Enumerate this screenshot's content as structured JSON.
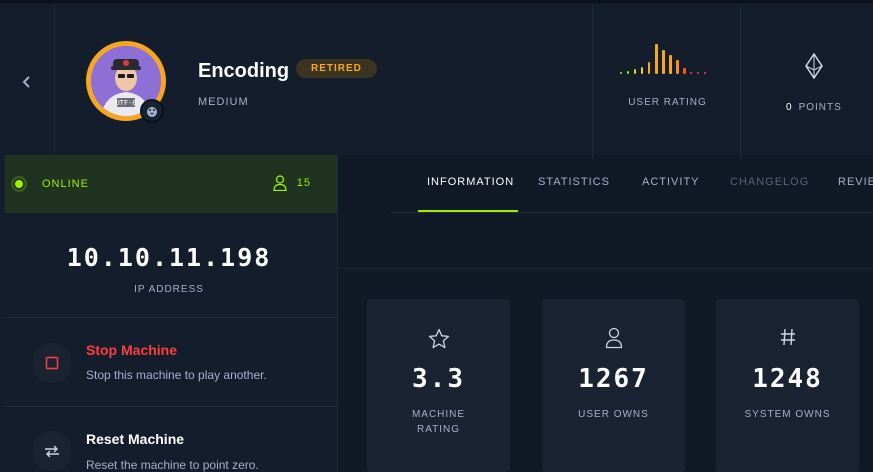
{
  "header": {
    "machine_name": "Encoding",
    "status_badge": "RETIRED",
    "difficulty": "MEDIUM",
    "user_rating_label": "USER RATING",
    "points_value": "0",
    "points_label": "POINTS"
  },
  "avatar": {
    "shirt_text": "UTF-8"
  },
  "left_panel": {
    "status": "ONLINE",
    "user_count": "15",
    "ip": "10.10.11.198",
    "ip_label": "IP ADDRESS",
    "actions": [
      {
        "title": "Stop Machine",
        "description": "Stop this machine to play another."
      },
      {
        "title": "Reset Machine",
        "description": "Reset the machine to point zero."
      }
    ]
  },
  "tabs": [
    "INFORMATION",
    "STATISTICS",
    "ACTIVITY",
    "CHANGELOG",
    "REVIE"
  ],
  "cards": [
    {
      "value": "3.3",
      "label": "MACHINE RATING",
      "icon": "star-icon"
    },
    {
      "value": "1267",
      "label": "USER OWNS",
      "icon": "user-icon"
    },
    {
      "value": "1248",
      "label": "SYSTEM OWNS",
      "icon": "hash-icon"
    }
  ],
  "colors": {
    "accent_green": "#9fef00",
    "stop_red": "#ff3e3e",
    "retired_orange": "#f6a623"
  }
}
